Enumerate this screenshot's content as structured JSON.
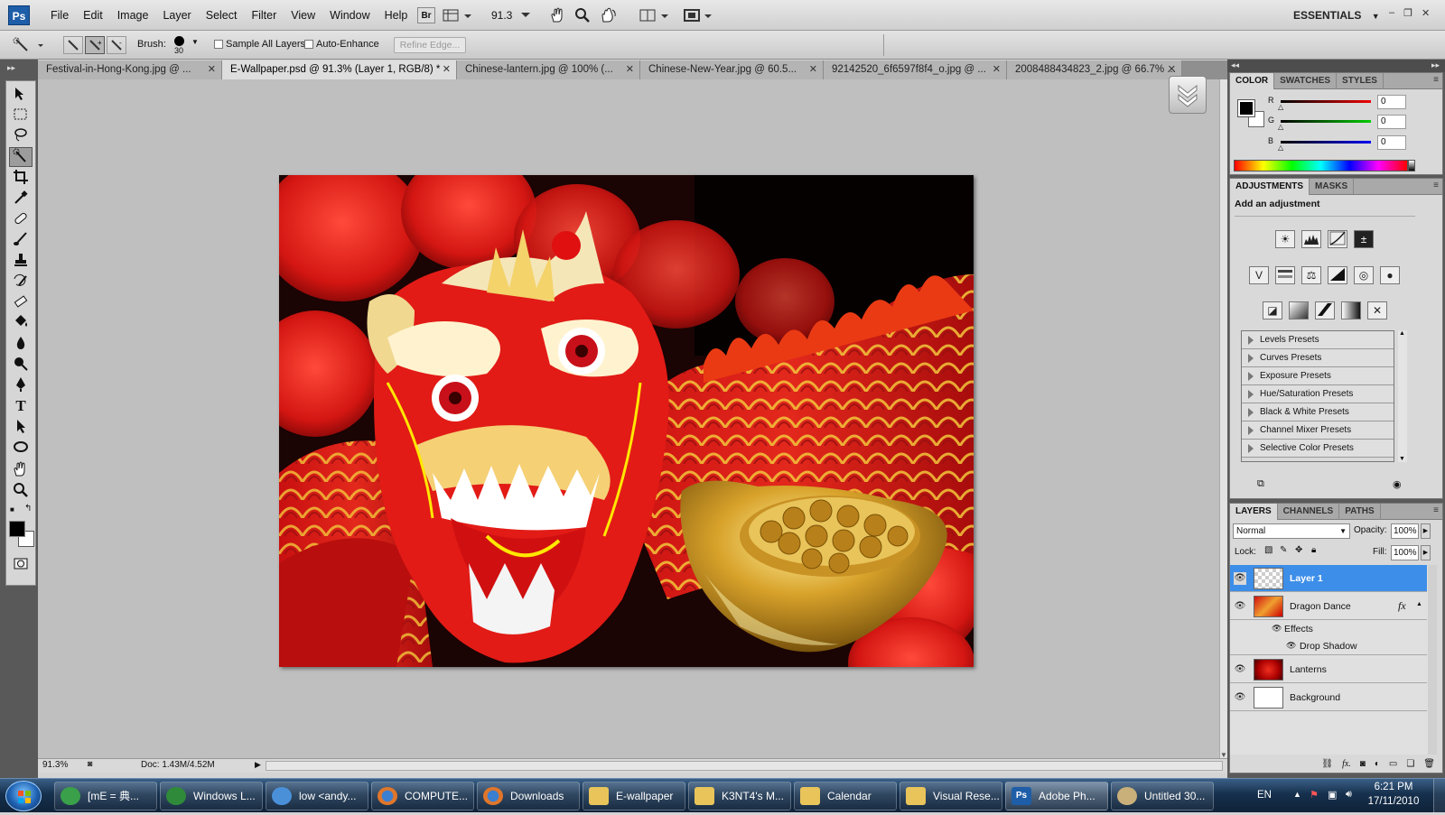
{
  "menubar": {
    "logo": "Ps",
    "menus": [
      "File",
      "Edit",
      "Image",
      "Layer",
      "Select",
      "Filter",
      "View",
      "Window",
      "Help"
    ],
    "bridge_label": "Br",
    "zoom": "91.3",
    "workspace": "ESSENTIALS"
  },
  "options": {
    "brush_label": "Brush:",
    "brush_size": "30",
    "sample_all_layers": "Sample All Layers",
    "auto_enhance": "Auto-Enhance",
    "refine_edge": "Refine Edge..."
  },
  "tabs": [
    {
      "label": "Festival-in-Hong-Kong.jpg @ ...",
      "active": false
    },
    {
      "label": "E-Wallpaper.psd @ 91.3% (Layer 1, RGB/8) *",
      "active": true
    },
    {
      "label": "Chinese-lantern.jpg @ 100% (...",
      "active": false
    },
    {
      "label": "Chinese-New-Year.jpg @ 60.5...",
      "active": false
    },
    {
      "label": "92142520_6f6597f8f4_o.jpg @ ...",
      "active": false
    },
    {
      "label": "2008488434823_2.jpg @ 66.7% ...",
      "active": false
    }
  ],
  "status": {
    "zoom": "91.3%",
    "doc": "Doc: 1.43M/4.52M"
  },
  "color_panel": {
    "tabs": [
      "COLOR",
      "SWATCHES",
      "STYLES"
    ],
    "channels": [
      {
        "label": "R",
        "value": "0",
        "color": "#cc0000"
      },
      {
        "label": "G",
        "value": "0",
        "color": "#00aa00"
      },
      {
        "label": "B",
        "value": "0",
        "color": "#0000cc"
      }
    ]
  },
  "adjustments_panel": {
    "tabs": [
      "ADJUSTMENTS",
      "MASKS"
    ],
    "heading": "Add an adjustment",
    "presets": [
      "Levels Presets",
      "Curves Presets",
      "Exposure Presets",
      "Hue/Saturation Presets",
      "Black & White Presets",
      "Channel Mixer Presets",
      "Selective Color Presets"
    ]
  },
  "layers_panel": {
    "tabs": [
      "LAYERS",
      "CHANNELS",
      "PATHS"
    ],
    "blend_mode": "Normal",
    "opacity_label": "Opacity:",
    "opacity": "100%",
    "lock_label": "Lock:",
    "fill_label": "Fill:",
    "fill": "100%",
    "layers": [
      {
        "name": "Layer 1",
        "selected": true
      },
      {
        "name": "Dragon Dance",
        "selected": false,
        "fx": "fx"
      },
      {
        "name": "Effects",
        "sub": true
      },
      {
        "name": "Drop Shadow",
        "sub": true
      },
      {
        "name": "Lanterns",
        "selected": false
      },
      {
        "name": "Background",
        "selected": false
      }
    ]
  },
  "taskbar": {
    "items": [
      {
        "label": "[mE = 典...",
        "icon": "messenger-icon",
        "color": "#3aa04a"
      },
      {
        "label": "Windows L...",
        "icon": "live-messenger-icon",
        "color": "#2f8a3a"
      },
      {
        "label": "low <andy...",
        "icon": "messenger-person-icon",
        "color": "#4a90d9"
      },
      {
        "label": "COMPUTE...",
        "icon": "firefox-icon",
        "color": "#e0762a"
      },
      {
        "label": "Downloads",
        "icon": "firefox-icon",
        "color": "#e0762a"
      },
      {
        "label": "E-wallpaper",
        "icon": "folder-icon",
        "color": "#e9c45a"
      },
      {
        "label": "K3NT4's M...",
        "icon": "folder-icon",
        "color": "#e9c45a"
      },
      {
        "label": "Calendar",
        "icon": "folder-icon",
        "color": "#e9c45a"
      },
      {
        "label": "Visual Rese...",
        "icon": "folder-icon",
        "color": "#e9c45a"
      },
      {
        "label": "Adobe Ph...",
        "icon": "photoshop-icon",
        "color": "#1e5ea8",
        "active": true
      },
      {
        "label": "Untitled 30...",
        "icon": "paint-icon",
        "color": "#c9b07a"
      }
    ],
    "lang": "EN",
    "time": "6:21 PM",
    "date": "17/11/2010"
  }
}
